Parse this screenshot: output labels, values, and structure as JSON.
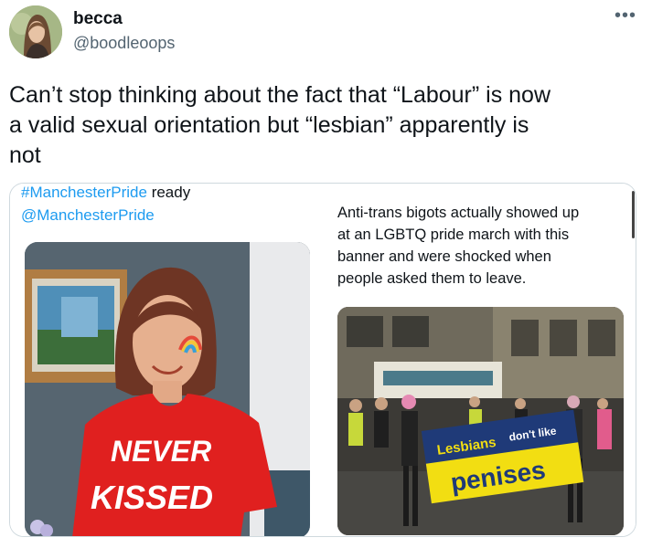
{
  "author": {
    "display_name": "becca",
    "handle": "@boodleoops",
    "more_icon": "•••"
  },
  "tweet": {
    "text_line1": "Can’t stop thinking about the fact that “Labour” is now",
    "text_line2": "a valid sexual orientation but “lesbian” apparently is",
    "text_line3": "not"
  },
  "left_image": {
    "hashtag": "#ManchesterPride",
    "hashtag_suffix": " ready",
    "mention": "@ManchesterPride",
    "shirt_line1": "NEVER",
    "shirt_line2": "KISSED"
  },
  "right_image": {
    "caption_line1": "Anti-trans bigots actually showed up",
    "caption_line2": "at an LGBTQ pride march with this",
    "caption_line3": "banner and were shocked when",
    "caption_line4": "people asked them to leave.",
    "banner_word1": "Lesbians",
    "banner_word2": "don't like",
    "banner_word3": "penises"
  },
  "colors": {
    "link": "#1d9bf0",
    "secondary_text": "#536471",
    "border": "#cfd9de",
    "shirt_red": "#e0201f",
    "banner_yellow": "#f2de12",
    "banner_navy": "#1f3a78"
  }
}
